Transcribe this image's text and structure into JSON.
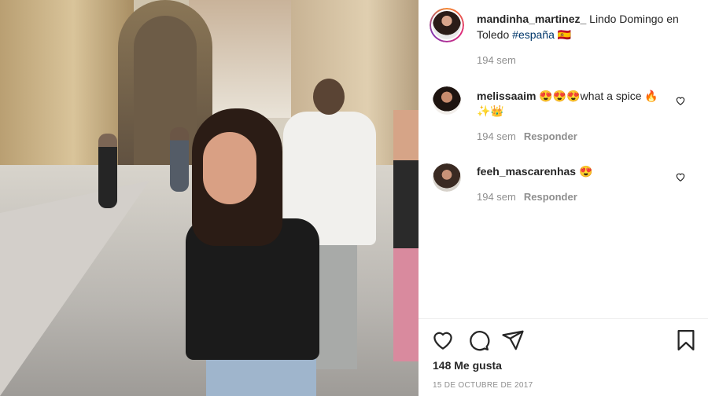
{
  "post": {
    "author": "mandinha_martinez_",
    "caption_text": " Lindo Domingo en Toledo ",
    "hashtag": "#españa",
    "flag": "🇪🇸",
    "time": "194 sem"
  },
  "comments": [
    {
      "username": "melissaaim",
      "text": "😍😍😍what a spice 🔥✨👑",
      "time": "194 sem",
      "reply_label": "Responder"
    },
    {
      "username": "feeh_mascarenhas",
      "text": "😍",
      "time": "194 sem",
      "reply_label": "Responder"
    }
  ],
  "footer": {
    "likes": "148 Me gusta",
    "date": "15 DE OCTUBRE DE 2017"
  },
  "icons": {
    "like": "heart-icon",
    "comment": "comment-icon",
    "share": "share-icon",
    "save": "bookmark-icon"
  },
  "colors": {
    "text": "#262626",
    "secondary": "#8e8e8e",
    "hashtag": "#00376b",
    "divider": "#efefef"
  }
}
